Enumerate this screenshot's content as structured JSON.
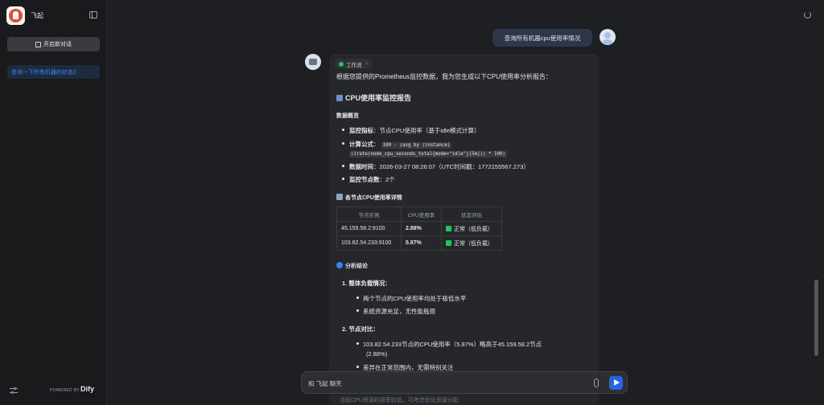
{
  "sidebar": {
    "app_name": "飞起",
    "new_chat_label": "开启新对话",
    "conversations": [
      "查询一下所有机器的状态2"
    ],
    "powered_by": "POWERED BY",
    "brand": "Dify"
  },
  "chat": {
    "user_message": "查询所有机器cpu使用率情况",
    "workflow_label": "工作流",
    "intro": "根据您提供的Prometheus监控数据，我为您生成以下CPU使用率分析报告：",
    "report_title": "CPU使用率监控报告",
    "overview_heading": "数据概览",
    "overview": {
      "metric_label": "监控指标",
      "metric_value": "：节点CPU使用率（基于idle模式计算）",
      "formula_label": "计算公式",
      "formula_line1": "100 - (avg by (instance)",
      "formula_line2": "(irate(node_cpu_seconds_total{mode=\"idle\"}[5m])) * 100)",
      "time_label": "数据时间",
      "time_value": "：2026-03-27 08:26:07（UTC时间戳：1772155567.273）",
      "nodes_label": "监控节点数",
      "nodes_value": "：2个"
    },
    "detail_heading": "各节点CPU使用率详情",
    "table": {
      "headers": [
        "节点实例",
        "CPU使用率",
        "状态评估"
      ],
      "rows": [
        [
          "45.159.58.2:9100",
          "2.88%",
          "正常（低负载）"
        ],
        [
          "103.82.54.233:9100",
          "5.87%",
          "正常（低负载）"
        ]
      ]
    },
    "analysis_heading": "分析结论",
    "analysis": {
      "item1_title": "1. 整体负载情况：",
      "item1_points": [
        "两个节点的CPU使用率均处于极低水平",
        "系统资源充足，无性能瓶颈"
      ],
      "item2_title": "2. 节点对比：",
      "item2_point1_line1": "103.82.54.233节点的CPU使用率（5.87%）略高于45.159.58.2节点",
      "item2_point1_line2": "(2.88%)",
      "item2_point2": "差异在正常范围内，无需特别关注"
    },
    "faded_text": "当前CPU资源利用率较低，可考虑优化资源分配"
  },
  "input": {
    "placeholder": "和 飞起 聊天"
  },
  "colors": {
    "accent": "#2563eb",
    "link": "#3b82f6",
    "ok": "#22c55e"
  }
}
